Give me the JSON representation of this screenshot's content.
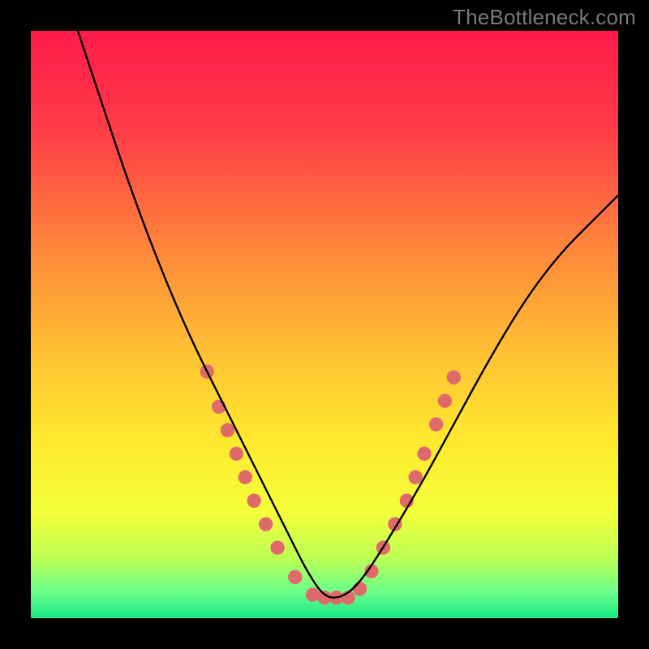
{
  "watermark": "TheBottleneck.com",
  "chart_data": {
    "type": "line",
    "title": "",
    "xlabel": "",
    "ylabel": "",
    "xlim": [
      0,
      100
    ],
    "ylim": [
      0,
      100
    ],
    "grid": false,
    "legend": false,
    "note": "V-shaped bottleneck curve over a vertical spectrum gradient. No numeric axes shown; x/y are relative 0-100 units inferred from geometry.",
    "series": [
      {
        "name": "bottleneck-curve",
        "color": "#000000",
        "x": [
          8,
          12,
          16,
          20,
          24,
          28,
          32,
          36,
          40,
          44,
          47,
          50,
          53,
          56,
          60,
          66,
          72,
          78,
          84,
          90,
          96,
          100
        ],
        "y": [
          100,
          88,
          76,
          65,
          55,
          46,
          38,
          30,
          22,
          14,
          8,
          3.5,
          3.5,
          6,
          12,
          22,
          33,
          44,
          54,
          62,
          68,
          72
        ]
      }
    ],
    "markers": {
      "name": "highlight-dots",
      "color": "#e06a6a",
      "radius_rel": 1.2,
      "points": [
        {
          "x": 30,
          "y": 42
        },
        {
          "x": 32,
          "y": 36
        },
        {
          "x": 33.5,
          "y": 32
        },
        {
          "x": 35,
          "y": 28
        },
        {
          "x": 36.5,
          "y": 24
        },
        {
          "x": 38,
          "y": 20
        },
        {
          "x": 40,
          "y": 16
        },
        {
          "x": 42,
          "y": 12
        },
        {
          "x": 45,
          "y": 7
        },
        {
          "x": 48,
          "y": 4
        },
        {
          "x": 50,
          "y": 3.5
        },
        {
          "x": 52,
          "y": 3.5
        },
        {
          "x": 54,
          "y": 3.5
        },
        {
          "x": 56,
          "y": 5
        },
        {
          "x": 58,
          "y": 8
        },
        {
          "x": 60,
          "y": 12
        },
        {
          "x": 62,
          "y": 16
        },
        {
          "x": 64,
          "y": 20
        },
        {
          "x": 65.5,
          "y": 24
        },
        {
          "x": 67,
          "y": 28
        },
        {
          "x": 69,
          "y": 33
        },
        {
          "x": 70.5,
          "y": 37
        },
        {
          "x": 72,
          "y": 41
        }
      ]
    },
    "gradient_stops": [
      {
        "offset": 0,
        "color": "#ff1a4b"
      },
      {
        "offset": 18,
        "color": "#ff3f47"
      },
      {
        "offset": 38,
        "color": "#ff8a3a"
      },
      {
        "offset": 55,
        "color": "#ffc233"
      },
      {
        "offset": 70,
        "color": "#ffe92e"
      },
      {
        "offset": 82,
        "color": "#f3ff3a"
      },
      {
        "offset": 90,
        "color": "#baff55"
      },
      {
        "offset": 95.5,
        "color": "#6bff8a"
      },
      {
        "offset": 100,
        "color": "#17e884"
      }
    ]
  }
}
